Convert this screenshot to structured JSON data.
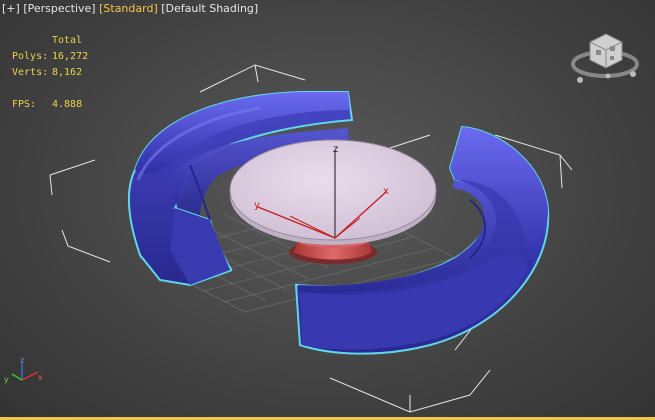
{
  "viewport_label": {
    "plus": "[+]",
    "view": "[Perspective]",
    "mode": "[Standard]",
    "shading": "[Default Shading]"
  },
  "stats": {
    "header": "Total",
    "polys_label": "Polys:",
    "polys_value": "16,272",
    "verts_label": "Verts:",
    "verts_value": "8,162",
    "fps_label": "FPS:",
    "fps_value": "4.888"
  },
  "gizmo": {
    "x_label": "x",
    "y_label": "y",
    "z_label": "z"
  },
  "colors": {
    "sofa": "#4b4bcf",
    "selection": "#5fd6ea",
    "table_top": "#d9c9dc",
    "table_base": "#cc4b4b",
    "label_active": "#f3c54a",
    "stats_text": "#e9d34a"
  },
  "icons": [
    "viewcube-icon",
    "axis-tripod-icon",
    "transform-gizmo-icon"
  ]
}
